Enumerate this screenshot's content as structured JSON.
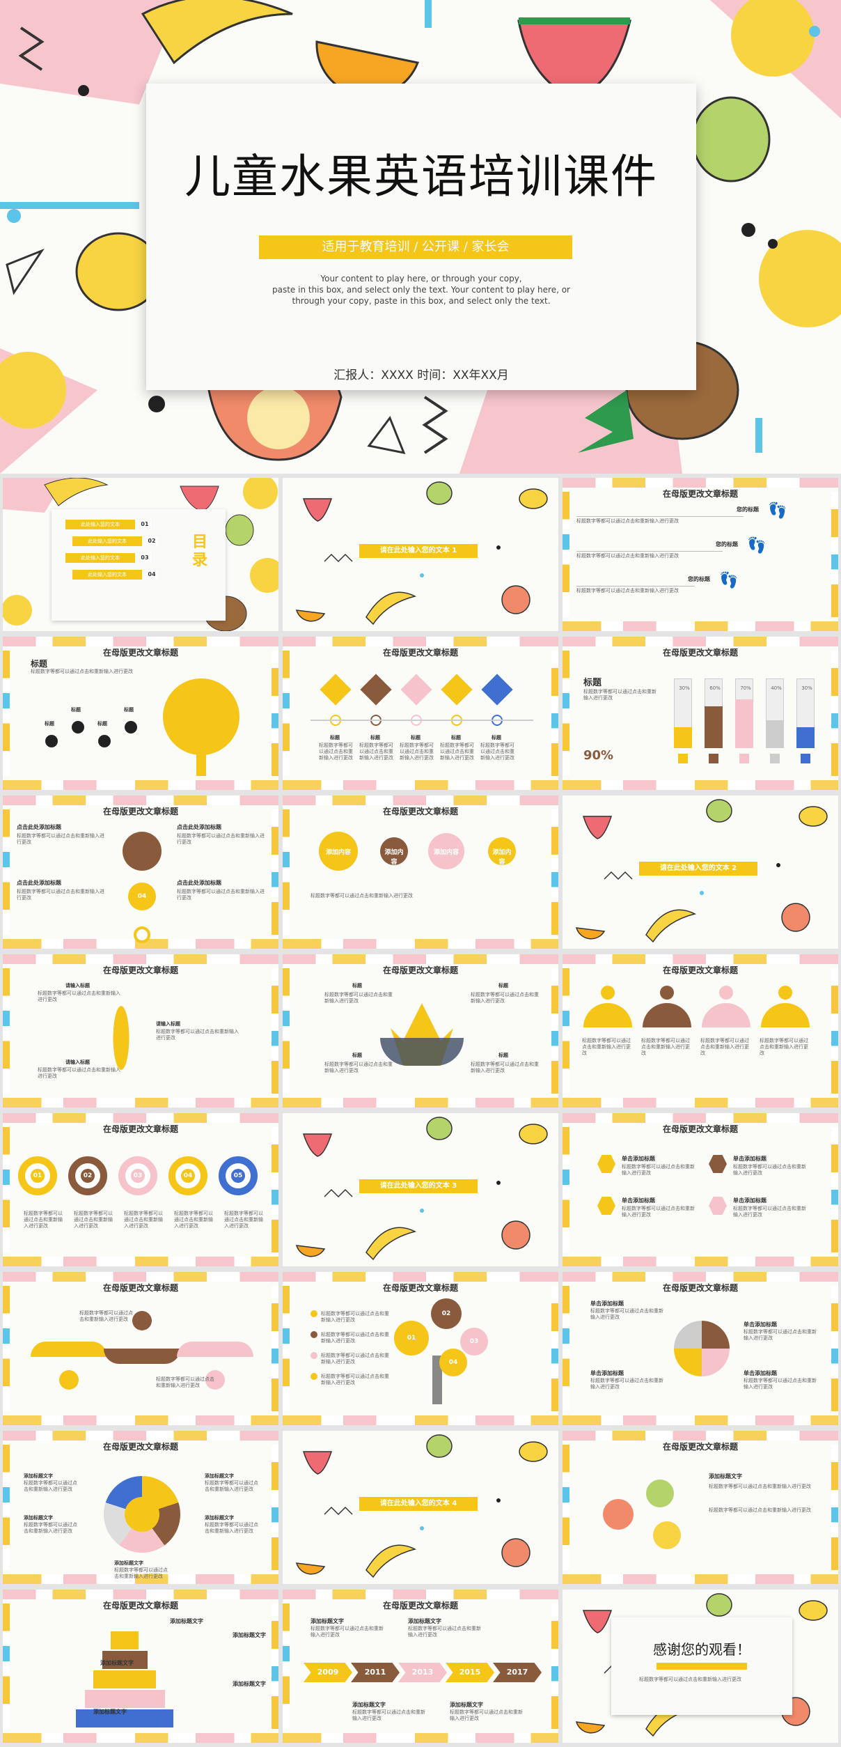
{
  "hero": {
    "title": "儿童水果英语培训课件",
    "subtitle": "适用于教育培训 / 公开课 / 家长会",
    "body_line1": "Your content to play here, or through your copy,",
    "body_line2": "paste in this box, and select only the text. Your content to play here, or",
    "body_line3": "through your copy, paste in this box, and select only the text.",
    "reporter": "汇报人：XXXX    时间：XX年XX月"
  },
  "common": {
    "slide_title": "在母版更改文章标题",
    "section_prompt": "请在此处输入您的文本",
    "body_text": "标题数字等都可以通过点击和重新输入进行更改",
    "click_add_title": "点击此处添加标题",
    "click_add_text": "单击添加标题",
    "add_title_text": "添加标题文字",
    "please_input": "请输入标题",
    "title_word": "标题",
    "your_title": "您的标题",
    "add_content": "添加内容"
  },
  "toc": {
    "heading": "目录",
    "items": [
      {
        "label": "此处输入您的文本",
        "num": "01"
      },
      {
        "label": "此处输入您的文本",
        "num": "02"
      },
      {
        "label": "此处输入您的文本",
        "num": "03"
      },
      {
        "label": "此处输入您的文本",
        "num": "04"
      }
    ]
  },
  "sections": [
    "1",
    "2",
    "3",
    "4"
  ],
  "percent": "90%",
  "bottle_pcts": [
    "30%",
    "60%",
    "70%",
    "40%",
    "30%"
  ],
  "timeline_years": [
    "2009",
    "2011",
    "2013",
    "2015",
    "2017"
  ],
  "step_nums": [
    "01",
    "02",
    "03",
    "04",
    "05"
  ],
  "thanks": "感谢您的观看！",
  "colors": {
    "yellow": "#f5c518",
    "brown": "#8a5a3c",
    "pink": "#f6c3cb",
    "blue": "#5bc4e8",
    "bg": "#fbfbf8"
  }
}
